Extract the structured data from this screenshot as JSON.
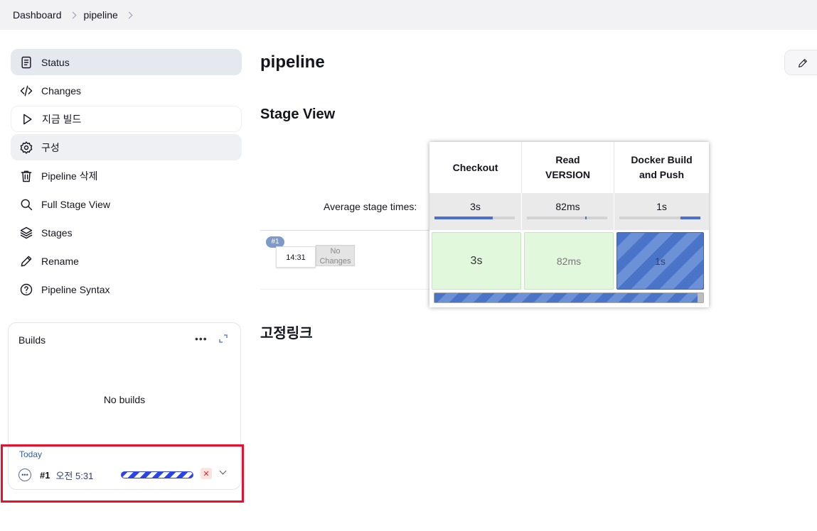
{
  "breadcrumb": {
    "items": [
      "Dashboard",
      "pipeline"
    ]
  },
  "sidebar": {
    "items": [
      {
        "label": "Status",
        "icon": "document-icon"
      },
      {
        "label": "Changes",
        "icon": "code-icon"
      },
      {
        "label": "지금 빌드",
        "icon": "play-icon"
      },
      {
        "label": "구성",
        "icon": "gear-icon"
      },
      {
        "label": "Pipeline 삭제",
        "icon": "trash-icon"
      },
      {
        "label": "Full Stage View",
        "icon": "search-icon"
      },
      {
        "label": "Stages",
        "icon": "layers-icon"
      },
      {
        "label": "Rename",
        "icon": "pencil-icon"
      },
      {
        "label": "Pipeline Syntax",
        "icon": "help-icon"
      }
    ]
  },
  "builds": {
    "title": "Builds",
    "more": "•••",
    "empty_text": "No builds",
    "group_label": "Today",
    "run": {
      "number": "#1",
      "time": "오전 5:31",
      "cancel": "✕"
    }
  },
  "main": {
    "title": "pipeline",
    "stage_view_title": "Stage View",
    "permalinks_title": "고정링크"
  },
  "stage_view": {
    "avg_label": "Average stage times:",
    "stages": [
      {
        "name_line1": "Checkout",
        "name_line2": "",
        "avg": "3s",
        "avg_fill": 0.72
      },
      {
        "name_line1": "Read",
        "name_line2": "VERSION",
        "avg": "82ms",
        "avg_fill": 0.02
      },
      {
        "name_line1": "Docker Build",
        "name_line2": "and Push",
        "avg": "1s",
        "avg_fill": 0.25
      }
    ],
    "run": {
      "badge": "#1",
      "time": "14:31",
      "changes_line1": "No",
      "changes_line2": "Changes",
      "cells": [
        {
          "value": "3s",
          "state": "success"
        },
        {
          "value": "82ms",
          "state": "success"
        },
        {
          "value": "1s",
          "state": "running"
        }
      ],
      "progress": 0.98
    }
  },
  "colors": {
    "highlight": "#e8112d",
    "accent": "#4a74c8",
    "success_bg": "#e2f8dc"
  }
}
